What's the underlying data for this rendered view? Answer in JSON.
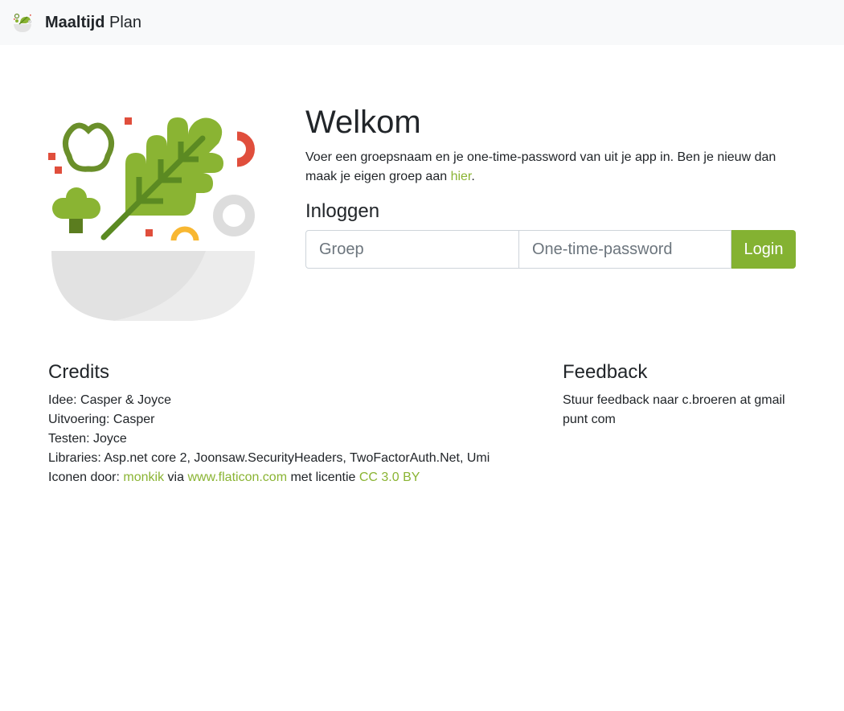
{
  "navbar": {
    "brand_bold": "Maaltijd",
    "brand_rest": "Plan",
    "logo_icon": "salad-bowl-icon"
  },
  "hero": {
    "illustration_icon": "salad-bowl-icon",
    "title": "Welkom",
    "intro_text": "Voer een groepsnaam en je one-time-password van uit je app in. Ben je nieuw dan maak je eigen groep aan ",
    "intro_link": "hier",
    "intro_end": "."
  },
  "login": {
    "heading": "Inloggen",
    "group_placeholder": "Groep",
    "group_value": "",
    "otp_placeholder": "One-time-password",
    "otp_value": "",
    "button_label": "Login"
  },
  "credits": {
    "heading": "Credits",
    "idea": "Idee: Casper & Joyce",
    "execution": "Uitvoering: Casper",
    "testing": "Testen: Joyce",
    "libraries": "Libraries: Asp.net core 2, Joonsaw.SecurityHeaders, TwoFactorAuth.Net, Umi",
    "icons_prefix": "Iconen door: ",
    "icons_author": "monkik",
    "icons_via": " via ",
    "icons_site": "www.flaticon.com",
    "icons_license_prefix": " met licentie ",
    "icons_license": "CC 3.0 BY"
  },
  "feedback": {
    "heading": "Feedback",
    "text": "Stuur feedback naar c.broeren at gmail punt com"
  },
  "colors": {
    "accent": "#84b232",
    "link": "#8ab433",
    "navbar_bg": "#f8f9fa"
  }
}
